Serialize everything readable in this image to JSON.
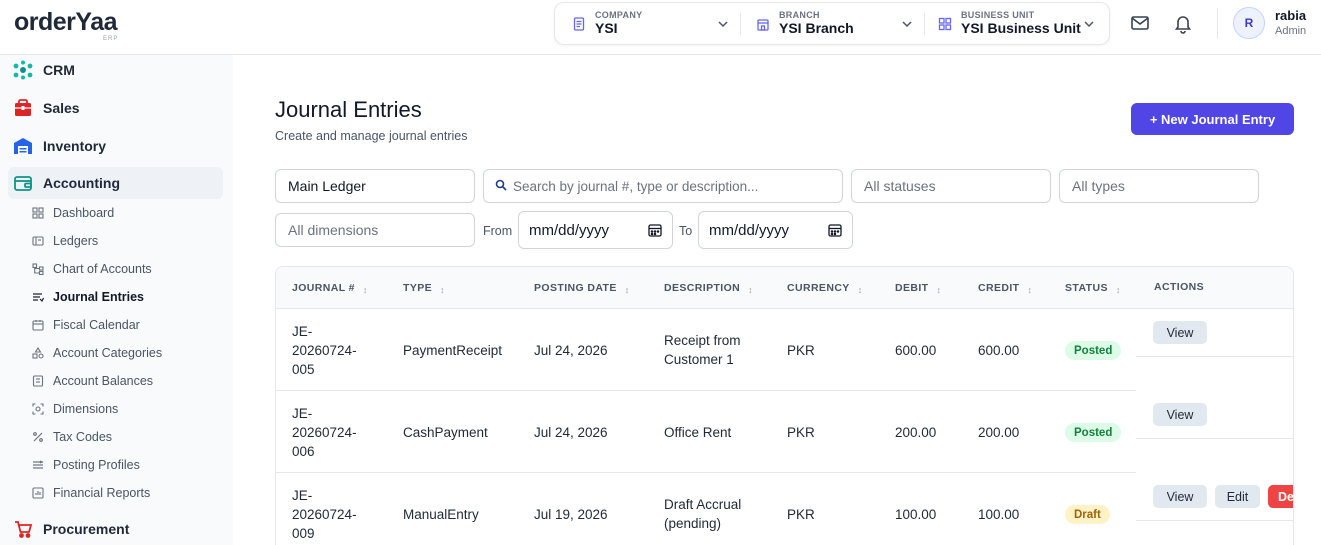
{
  "brand": {
    "name_main": "order",
    "name_accent": "Yaa",
    "sub": "ERP"
  },
  "header": {
    "company": {
      "label": "COMPANY",
      "value": "YSI"
    },
    "branch": {
      "label": "BRANCH",
      "value": "YSI Branch"
    },
    "business_unit": {
      "label": "BUSINESS UNIT",
      "value": "YSI Business Unit"
    },
    "user": {
      "initial": "R",
      "name": "rabia",
      "role": "Admin"
    }
  },
  "sidebar": {
    "main": [
      {
        "label": "CRM",
        "icon": "crm-icon"
      },
      {
        "label": "Sales",
        "icon": "sales-icon"
      },
      {
        "label": "Inventory",
        "icon": "inventory-icon"
      },
      {
        "label": "Accounting",
        "icon": "accounting-icon"
      },
      {
        "label": "Procurement",
        "icon": "procurement-icon"
      }
    ],
    "accounting_items": [
      {
        "label": "Dashboard"
      },
      {
        "label": "Ledgers"
      },
      {
        "label": "Chart of Accounts"
      },
      {
        "label": "Journal Entries"
      },
      {
        "label": "Fiscal Calendar"
      },
      {
        "label": "Account Categories"
      },
      {
        "label": "Account Balances"
      },
      {
        "label": "Dimensions"
      },
      {
        "label": "Tax Codes"
      },
      {
        "label": "Posting Profiles"
      },
      {
        "label": "Financial Reports"
      }
    ]
  },
  "page": {
    "title": "Journal Entries",
    "subtitle": "Create and manage journal entries",
    "new_button": "+ New Journal Entry"
  },
  "filters": {
    "ledger": "Main Ledger",
    "search_placeholder": "Search by journal #, type or description...",
    "status": "All statuses",
    "type": "All types",
    "dimensions": "All dimensions",
    "from_label": "From",
    "to_label": "To",
    "from_date": "mm/dd/yyyy",
    "to_date": "mm/dd/yyyy"
  },
  "table": {
    "headers": [
      "JOURNAL #",
      "TYPE",
      "POSTING DATE",
      "DESCRIPTION",
      "CURRENCY",
      "DEBIT",
      "CREDIT",
      "STATUS",
      "ACTIONS"
    ],
    "rows": [
      {
        "journal_l1": "JE-",
        "journal_l2": "20260724-",
        "journal_l3": "005",
        "type": "PaymentReceipt",
        "date": "Jul 24, 2026",
        "desc_l1": "Receipt from",
        "desc_l2": "Customer 1",
        "currency": "PKR",
        "debit": "600.00",
        "credit": "600.00",
        "status": "Posted"
      },
      {
        "journal_l1": "JE-",
        "journal_l2": "20260724-",
        "journal_l3": "006",
        "type": "CashPayment",
        "date": "Jul 24, 2026",
        "desc_l1": "Office Rent",
        "desc_l2": "",
        "currency": "PKR",
        "debit": "200.00",
        "credit": "200.00",
        "status": "Posted"
      },
      {
        "journal_l1": "JE-",
        "journal_l2": "20260724-",
        "journal_l3": "009",
        "type": "ManualEntry",
        "date": "Jul 19, 2026",
        "desc_l1": "Draft Accrual",
        "desc_l2": "(pending)",
        "currency": "PKR",
        "debit": "100.00",
        "credit": "100.00",
        "status": "Draft"
      }
    ],
    "actions": {
      "view": "View",
      "edit": "Edit",
      "delete": "De"
    }
  },
  "colors": {
    "primary": "#4f46e5",
    "posted_bg": "#dcfce7",
    "posted_text": "#15803d",
    "draft_bg": "#fef3c7",
    "draft_text": "#a16207",
    "delete": "#ef4444"
  }
}
